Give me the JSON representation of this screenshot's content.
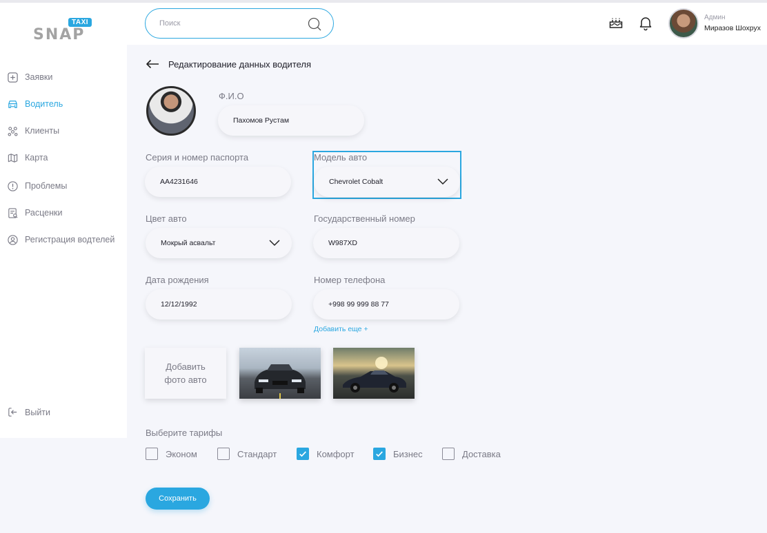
{
  "brand": {
    "logo_text": "SNAP",
    "logo_badge": "TAXI"
  },
  "sidebar": {
    "items": [
      {
        "label": "Заявки",
        "icon": "plus-square-icon",
        "active": false
      },
      {
        "label": "Водитель",
        "icon": "car-icon",
        "active": true
      },
      {
        "label": "Клиенты",
        "icon": "users-icon",
        "active": false
      },
      {
        "label": "Карта",
        "icon": "map-icon",
        "active": false
      },
      {
        "label": "Проблемы",
        "icon": "alert-circle-icon",
        "active": false
      },
      {
        "label": "Расценки",
        "icon": "price-list-icon",
        "active": false
      },
      {
        "label": "Регистрация водтелей",
        "icon": "driver-register-icon",
        "active": false
      }
    ],
    "logout_label": "Выйти"
  },
  "header": {
    "search_placeholder": "Поиск",
    "user_role": "Админ",
    "user_name": "Миразов Шохрух"
  },
  "page": {
    "title": "Редактирование данных водителя"
  },
  "form": {
    "fio": {
      "label": "Ф.И.О",
      "value": "Пахомов Рустам"
    },
    "passport": {
      "label": "Серия и номер паспорта",
      "value": "AA4231646"
    },
    "car_model": {
      "label": "Модель авто",
      "value": "Chevrolet Cobalt"
    },
    "car_color": {
      "label": "Цвет авто",
      "value": "Мокрый асвальт"
    },
    "plate": {
      "label": "Государственный номер",
      "value": "W987XD"
    },
    "birth_date": {
      "label": "Дата рождения",
      "value": "12/12/1992"
    },
    "phone": {
      "label": "Номер телефона",
      "value": "+998 99 999 88 77"
    },
    "add_more": "Добавить еще +",
    "add_photo_line1": "Добавить",
    "add_photo_line2": "фото авто"
  },
  "tariffs": {
    "label": "Выберите тарифы",
    "items": [
      {
        "label": "Эконом",
        "checked": false
      },
      {
        "label": "Стандарт",
        "checked": false
      },
      {
        "label": "Комфорт",
        "checked": true
      },
      {
        "label": "Бизнес",
        "checked": true
      },
      {
        "label": "Доставка",
        "checked": false
      }
    ]
  },
  "actions": {
    "save": "Сохранить"
  },
  "colors": {
    "accent": "#2aa7e0",
    "sidebar_text": "#7a7a86",
    "background": "#f5f6fb"
  }
}
